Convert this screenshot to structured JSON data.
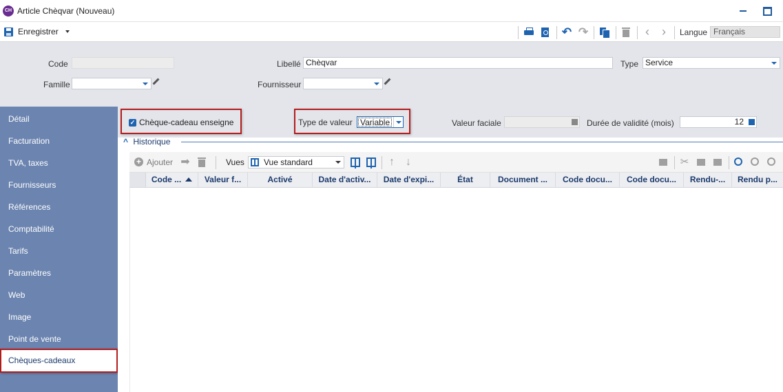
{
  "window": {
    "app_icon_text": "CH",
    "title": "Article Chèqvar (Nouveau)"
  },
  "toolbar": {
    "save_label": "Enregistrer",
    "language_label": "Langue",
    "language_value": "Français",
    "icons": [
      "print-icon",
      "print-preview-icon",
      "undo-icon",
      "redo-icon",
      "duplicate-icon",
      "trash-icon",
      "previous-icon",
      "next-icon"
    ]
  },
  "header": {
    "code_label": "Code",
    "code_value": "",
    "libelle_label": "Libellé",
    "libelle_value": "Chèqvar",
    "type_label": "Type",
    "type_value": "Service",
    "famille_label": "Famille",
    "famille_value": "",
    "fournisseur_label": "Fournisseur",
    "fournisseur_value": ""
  },
  "sidebar": {
    "items": [
      {
        "label": "Détail"
      },
      {
        "label": "Facturation"
      },
      {
        "label": "TVA, taxes"
      },
      {
        "label": "Fournisseurs"
      },
      {
        "label": "Références"
      },
      {
        "label": "Comptabilité"
      },
      {
        "label": "Tarifs"
      },
      {
        "label": "Paramètres"
      },
      {
        "label": "Web"
      },
      {
        "label": "Image"
      },
      {
        "label": "Point de vente"
      },
      {
        "label": "Chèques-cadeaux",
        "active": true
      }
    ]
  },
  "giftcard": {
    "checkbox_label": "Chèque-cadeau enseigne",
    "checkbox_checked": true,
    "type_valeur_label": "Type de valeur",
    "type_valeur_value": "Variable",
    "valeur_faciale_label": "Valeur faciale",
    "valeur_faciale_value": "",
    "duree_label": "Durée de validité (mois)",
    "duree_value": "12"
  },
  "historique": {
    "section_title": "Historique",
    "add_label": "Ajouter",
    "views_label": "Vues",
    "views_value": "Vue standard",
    "columns": [
      "Code ...",
      "Valeur f...",
      "Activé",
      "Date d'activ...",
      "Date d'expi...",
      "État",
      "Document ...",
      "Code docu...",
      "Code docu...",
      "Rendu-...",
      "Rendu p..."
    ],
    "rows": []
  },
  "colors": {
    "accent": "#1e63b0",
    "sidebar_bg": "#6b84b0",
    "highlight_border": "#b31b1b",
    "header_bg": "#e3e5ea",
    "column_text": "#1b3a6b"
  }
}
